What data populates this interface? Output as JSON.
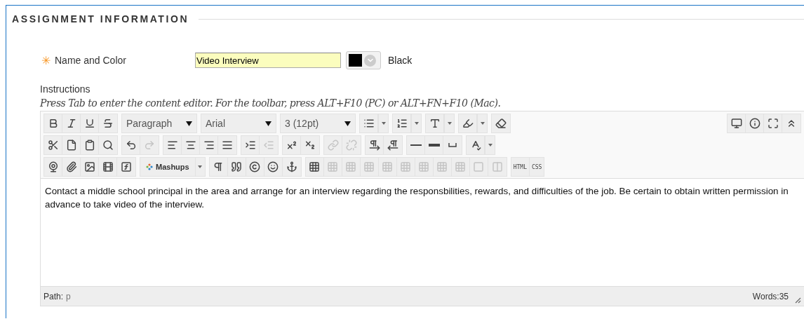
{
  "section": {
    "title": "ASSIGNMENT INFORMATION"
  },
  "name_field": {
    "required_mark": "✳",
    "label": "Name and Color",
    "value": "Video Interview",
    "color": "#000000",
    "color_name": "Black"
  },
  "instructions": {
    "label": "Instructions",
    "hint": "Press Tab to enter the content editor. For the toolbar, press ALT+F10 (PC) or ALT+FN+F10 (Mac)."
  },
  "toolbar": {
    "rows": [
      {
        "groups": [
          [
            {
              "kind": "button",
              "disabled": false
            },
            {
              "kind": "button",
              "disabled": false
            },
            {
              "kind": "button",
              "disabled": false
            },
            {
              "kind": "button",
              "disabled": false
            }
          ],
          [
            {
              "kind": "select",
              "label": "Paragraph"
            }
          ],
          [
            {
              "kind": "select",
              "label": "Arial"
            }
          ],
          [
            {
              "kind": "select",
              "label": "3 (12pt)"
            }
          ],
          [
            {
              "kind": "split",
              "disabled": false
            }
          ],
          [
            {
              "kind": "split",
              "disabled": false
            }
          ],
          [
            {
              "kind": "split",
              "disabled": false
            }
          ],
          [
            {
              "kind": "split",
              "disabled": false
            }
          ],
          [
            {
              "kind": "button",
              "disabled": false
            }
          ]
        ],
        "right": [
          [
            {
              "kind": "button",
              "disabled": false
            },
            {
              "kind": "button",
              "disabled": false
            },
            {
              "kind": "button",
              "disabled": false
            },
            {
              "kind": "button",
              "disabled": false
            }
          ]
        ]
      },
      {
        "groups": [
          [
            {
              "kind": "button",
              "disabled": false
            },
            {
              "kind": "button",
              "disabled": false
            },
            {
              "kind": "button",
              "disabled": false
            },
            {
              "kind": "button",
              "disabled": false
            }
          ],
          [
            {
              "kind": "button",
              "disabled": false
            },
            {
              "kind": "button",
              "disabled": true
            }
          ],
          [
            {
              "kind": "button",
              "disabled": false
            },
            {
              "kind": "button",
              "disabled": false
            },
            {
              "kind": "button",
              "disabled": false
            },
            {
              "kind": "button",
              "disabled": false
            }
          ],
          [
            {
              "kind": "button",
              "disabled": false
            },
            {
              "kind": "button",
              "disabled": true
            }
          ],
          [
            {
              "kind": "button",
              "disabled": false
            },
            {
              "kind": "button",
              "disabled": false
            }
          ],
          [
            {
              "kind": "button",
              "disabled": true
            },
            {
              "kind": "button",
              "disabled": true
            }
          ],
          [
            {
              "kind": "button",
              "disabled": false
            },
            {
              "kind": "button",
              "disabled": false
            }
          ],
          [
            {
              "kind": "button",
              "disabled": false
            },
            {
              "kind": "button",
              "disabled": false
            },
            {
              "kind": "button",
              "disabled": false
            }
          ],
          [
            {
              "kind": "split",
              "disabled": false
            }
          ]
        ]
      },
      {
        "groups": [
          [
            {
              "kind": "button",
              "disabled": false
            },
            {
              "kind": "button",
              "disabled": false
            },
            {
              "kind": "button",
              "disabled": false
            },
            {
              "kind": "button",
              "disabled": false
            },
            {
              "kind": "button",
              "disabled": false
            }
          ],
          [
            {
              "kind": "icon-select",
              "label": "Mashups"
            }
          ],
          [
            {
              "kind": "button",
              "disabled": false
            },
            {
              "kind": "button",
              "disabled": false
            },
            {
              "kind": "button",
              "disabled": false
            },
            {
              "kind": "button",
              "disabled": false
            },
            {
              "kind": "button",
              "disabled": false
            }
          ],
          [
            {
              "kind": "button",
              "disabled": false
            },
            {
              "kind": "button",
              "disabled": true
            },
            {
              "kind": "button",
              "disabled": true
            },
            {
              "kind": "button",
              "disabled": true
            },
            {
              "kind": "button",
              "disabled": true
            },
            {
              "kind": "button",
              "disabled": true
            },
            {
              "kind": "button",
              "disabled": true
            },
            {
              "kind": "button",
              "disabled": true
            },
            {
              "kind": "button",
              "disabled": true
            },
            {
              "kind": "button",
              "disabled": true
            },
            {
              "kind": "button",
              "disabled": true
            }
          ],
          [
            {
              "kind": "text",
              "label": "HTML"
            },
            {
              "kind": "text",
              "label": "CSS"
            }
          ]
        ]
      }
    ]
  },
  "content": "Contact a middle school principal in the area and arrange for an interview regarding the responsbilities, rewards, and difficulties of the job. Be certain to obtain written permission in advance to take video of the interview.",
  "status_bar": {
    "path_label": "Path:",
    "path": "p",
    "words": "Words:35"
  }
}
